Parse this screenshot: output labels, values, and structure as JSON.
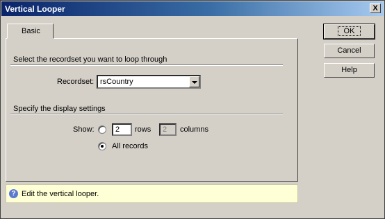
{
  "window": {
    "title": "Vertical Looper",
    "close_glyph": "X"
  },
  "tabs": [
    {
      "label": "Basic",
      "active": true
    }
  ],
  "section1": {
    "heading": "Select the recordset you want to loop through"
  },
  "recordset": {
    "label": "Recordset:",
    "value": "rsCountry"
  },
  "section2": {
    "heading": "Specify the display settings"
  },
  "show": {
    "label": "Show:",
    "rows_value": "2",
    "rows_label": "rows",
    "columns_value": "2",
    "columns_label": "columns",
    "all_records_label": "All records",
    "selected": "all_records"
  },
  "hint": {
    "text": "Edit the vertical looper.",
    "icon": "help-icon"
  },
  "buttons": {
    "ok": "OK",
    "cancel": "Cancel",
    "help": "Help"
  }
}
